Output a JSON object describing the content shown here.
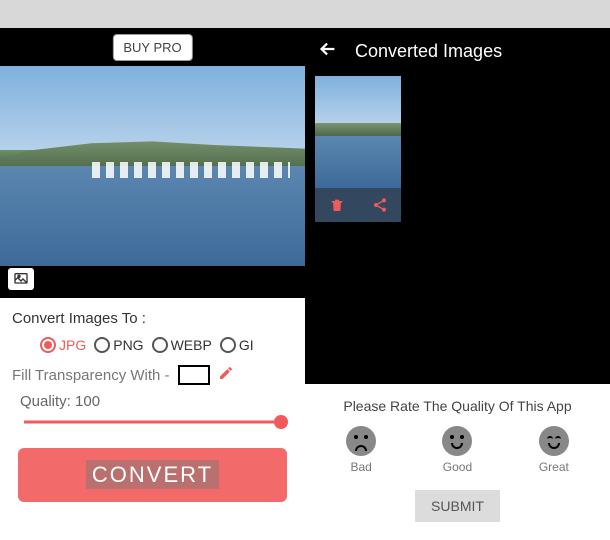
{
  "left": {
    "buy_pro_label": "BUY PRO",
    "convert_to_label": "Convert Images To :",
    "formats": [
      {
        "label": "JPG",
        "selected": true
      },
      {
        "label": "PNG",
        "selected": false
      },
      {
        "label": "WEBP",
        "selected": false
      },
      {
        "label": "GI",
        "selected": false
      }
    ],
    "fill_transparency_label": "Fill Transparency With -",
    "fill_color": "#ffffff",
    "quality_label": "Quality:",
    "quality_value": "100",
    "convert_button": "CONVERT"
  },
  "right": {
    "title": "Converted Images",
    "rating": {
      "prompt": "Please Rate The Quality Of This App",
      "options": [
        {
          "label": "Bad"
        },
        {
          "label": "Good"
        },
        {
          "label": "Great"
        }
      ],
      "submit_label": "SUBMIT"
    }
  },
  "colors": {
    "accent": "#f05a5a"
  }
}
